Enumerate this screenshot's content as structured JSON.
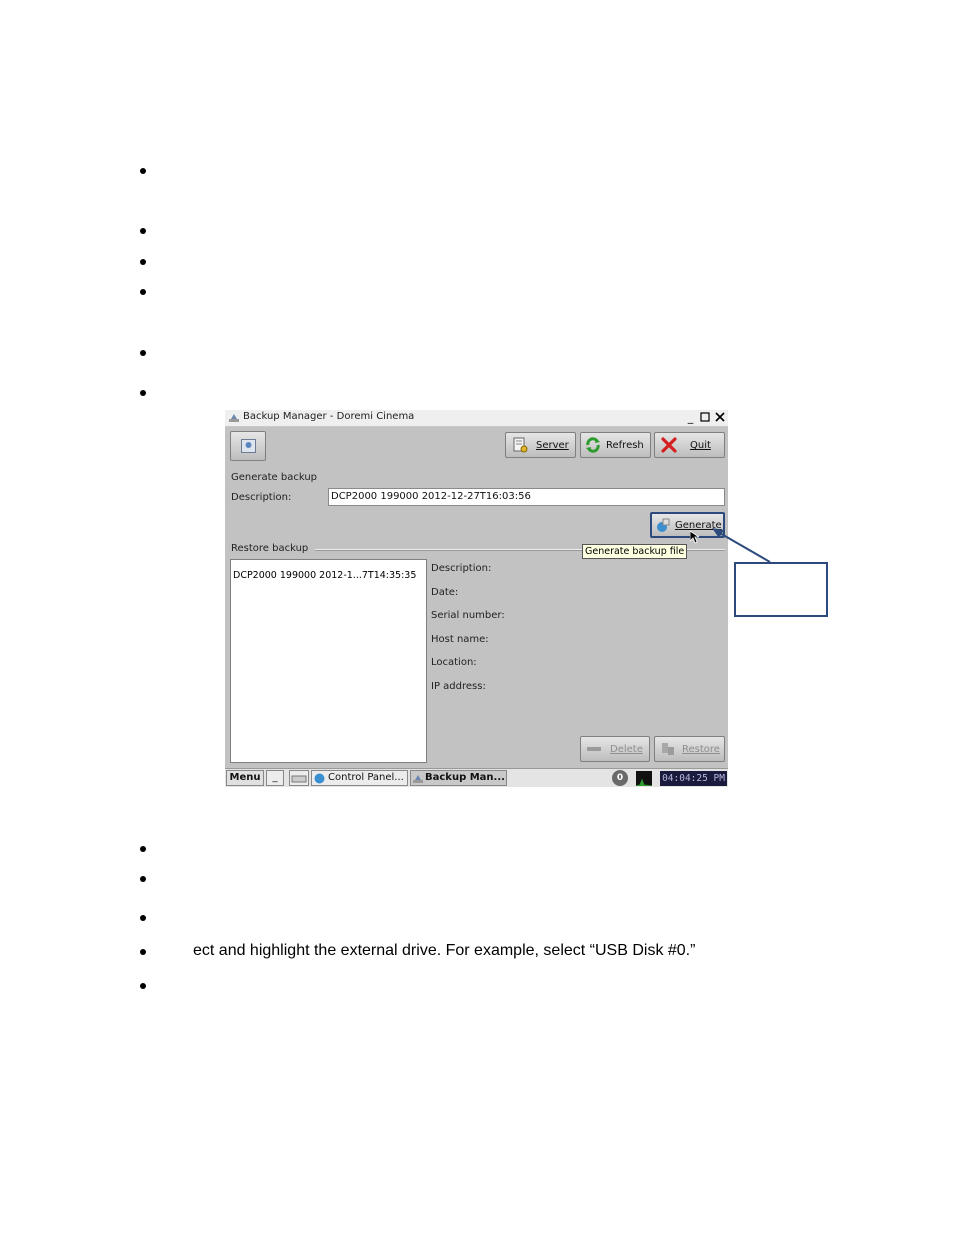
{
  "document": {
    "fragment_text": "ect and highlight the external drive. For example, select “USB Disk #0.”"
  },
  "window": {
    "title": "Backup Manager - Doremi Cinema",
    "toolbar": {
      "server_label": "Server",
      "refresh_label": "Refresh",
      "quit_label": "Quit"
    },
    "generate_section": {
      "heading": "Generate backup",
      "description_label": "Description:",
      "description_value": "DCP2000 199000 2012-12-27T16:03:56",
      "generate_label": "Generate",
      "tooltip": "Generate backup file"
    },
    "restore_section": {
      "heading": "Restore backup",
      "list_items": [
        "DCP2000 199000 2012-1...7T14:35:35"
      ],
      "fields": {
        "description": "Description:",
        "date": "Date:",
        "serial": "Serial number:",
        "host": "Host name:",
        "location": "Location:",
        "ip": "IP address:"
      },
      "delete_label": "Delete",
      "restore_label": "Restore"
    },
    "taskbar": {
      "menu_label": "Menu",
      "desktop_label": "_",
      "control_panel_label": "Control Panel...",
      "backup_label": "Backup Man...",
      "notification_count": "0",
      "clock": "04:04:25 PM"
    }
  },
  "colors": {
    "window_bg": "#c2c2c2",
    "callout": "#2c4a7c",
    "tooltip_bg": "#ffffe1",
    "clock_bg": "#1a1a3c"
  }
}
